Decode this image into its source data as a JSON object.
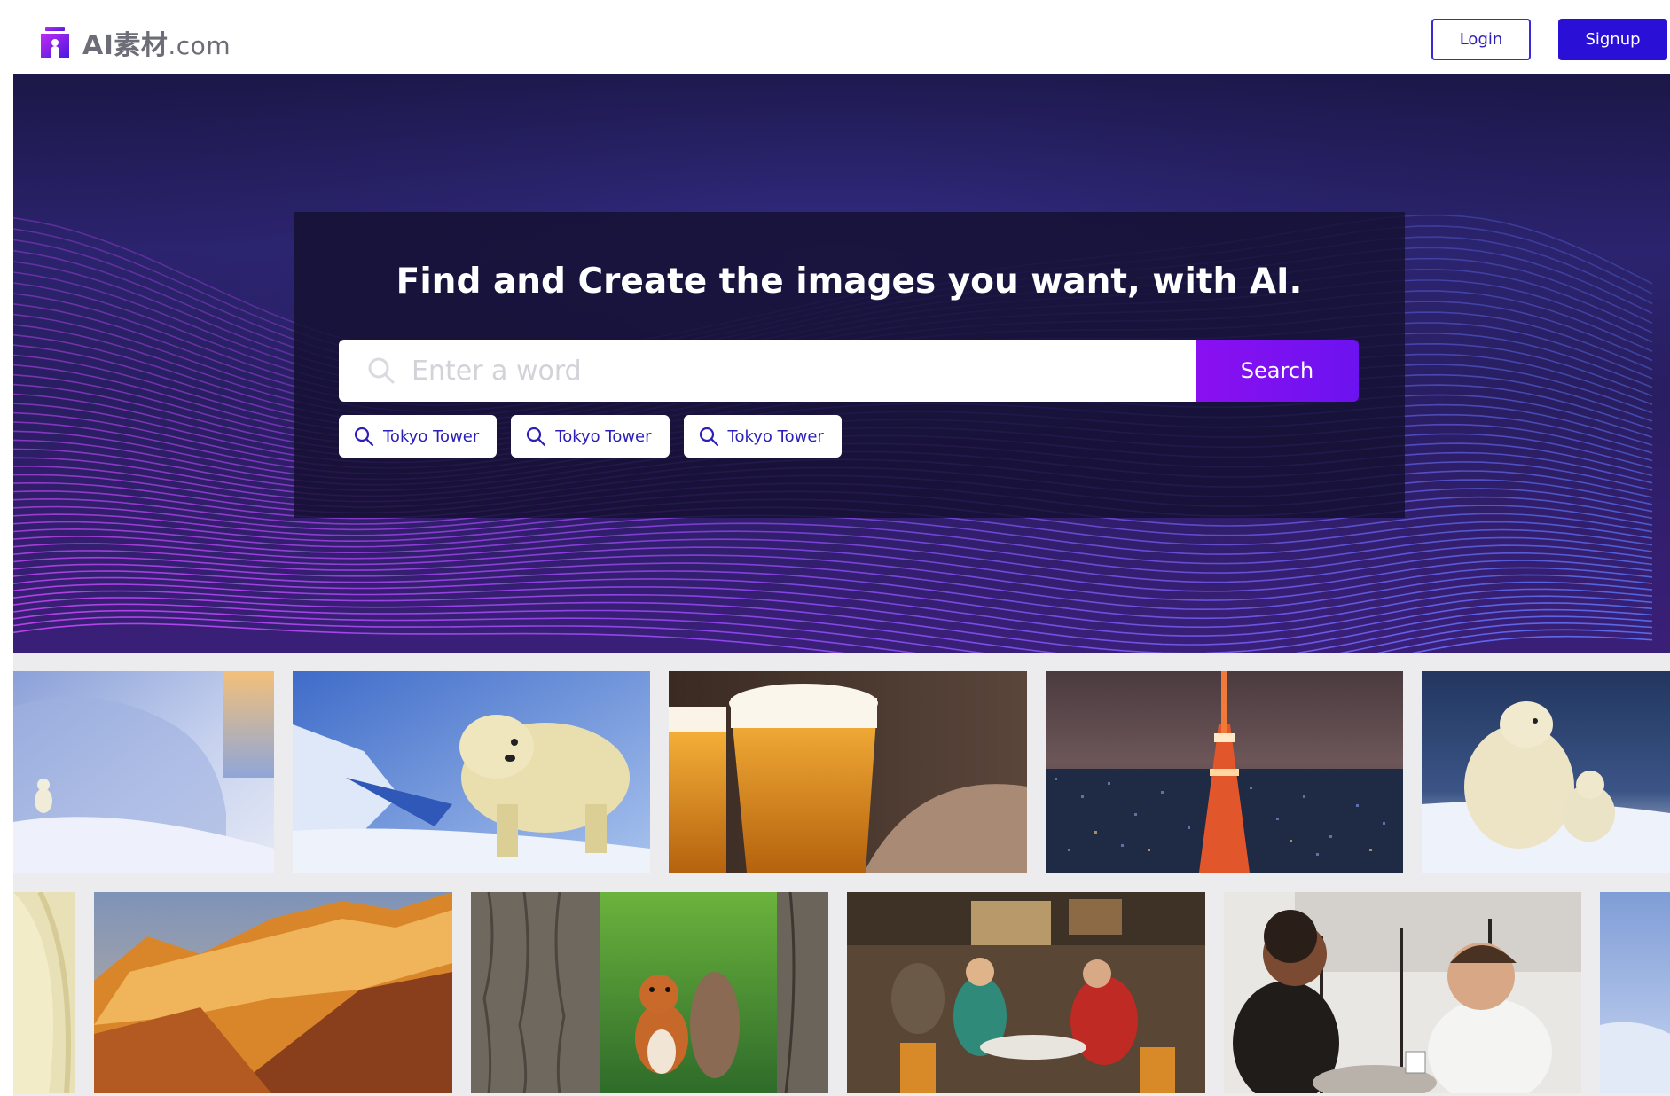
{
  "brand": {
    "name": "AI素材",
    "tld": ".com"
  },
  "nav": {
    "login_label": "Login",
    "signup_label": "Signup"
  },
  "hero": {
    "title": "Find and Create the images you want, with AI.",
    "search_placeholder": "Enter a word",
    "search_value": "",
    "search_button": "Search",
    "suggestions": [
      "Tokyo Tower",
      "Tokyo Tower",
      "Tokyo Tower"
    ]
  },
  "gallery": {
    "row1": [
      {
        "icon": "polar-bear-cub-in-snow-image"
      },
      {
        "icon": "polar-bear-on-ice-image"
      },
      {
        "icon": "beer-glasses-image"
      },
      {
        "icon": "tokyo-tower-night-image"
      },
      {
        "icon": "polar-bear-with-cub-image"
      }
    ],
    "row2": [
      {
        "icon": "polar-bear-fur-closeup-image"
      },
      {
        "icon": "sunlit-mountain-image"
      },
      {
        "icon": "squirrel-between-trees-image"
      },
      {
        "icon": "cafe-crowd-painting-image"
      },
      {
        "icon": "friends-laughing-cafe-image"
      },
      {
        "icon": "snowy-blue-image"
      }
    ]
  },
  "colors": {
    "brand_purple": "#2a10d6",
    "search_button": "#8b10f0",
    "hero_dark": "#1b1747",
    "wave_pink": "#c45bff",
    "wave_blue": "#5a6cff"
  }
}
